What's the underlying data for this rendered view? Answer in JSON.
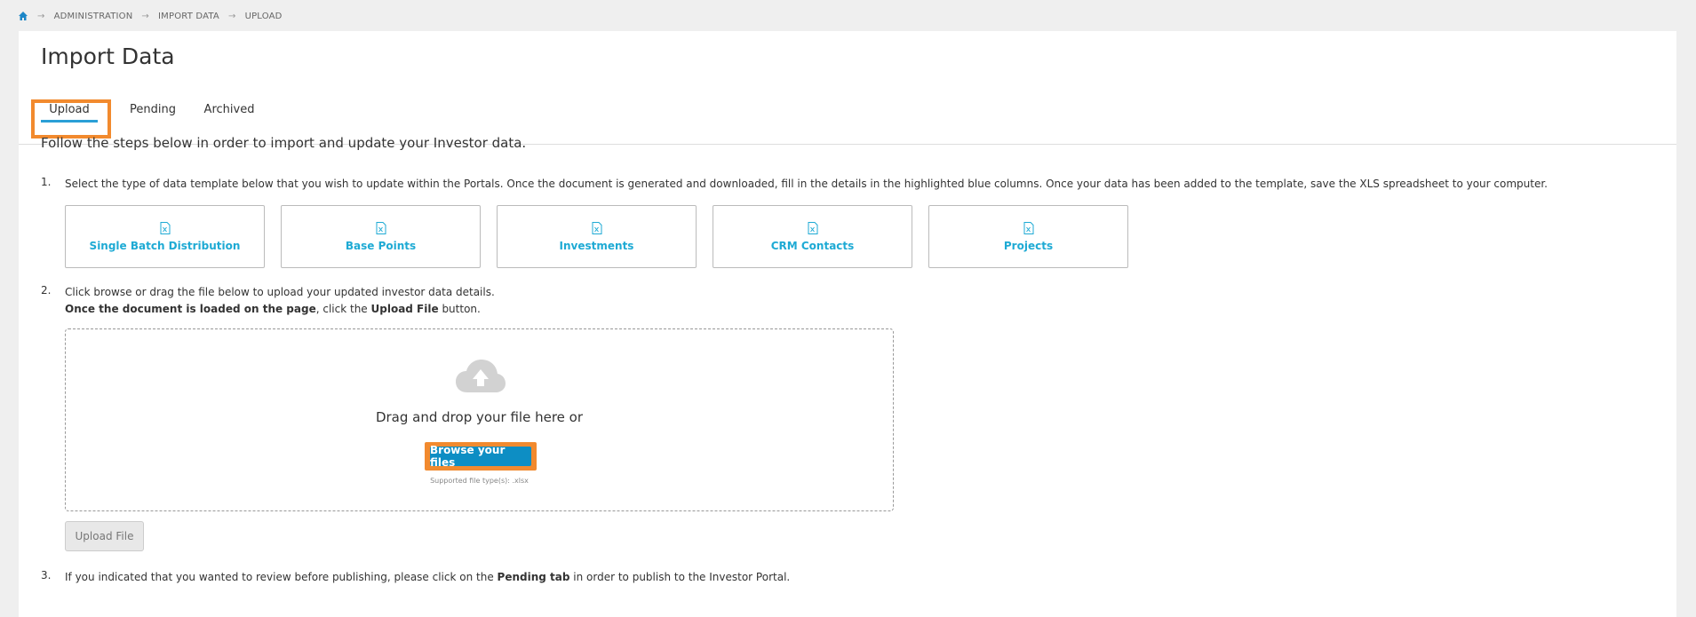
{
  "breadcrumb": {
    "home_icon": "home-icon",
    "items": [
      "ADMINISTRATION",
      "IMPORT DATA",
      "UPLOAD"
    ]
  },
  "page": {
    "title": "Import Data"
  },
  "tabs": [
    {
      "label": "Upload",
      "active": true
    },
    {
      "label": "Pending",
      "active": false
    },
    {
      "label": "Archived",
      "active": false
    }
  ],
  "intro": "Follow the steps below in order to import and update your Investor data.",
  "steps": {
    "step1": {
      "num": "1.",
      "text": "Select the type of data template below that you wish to update within the Portals. Once the document is generated and downloaded, fill in the details in the highlighted blue columns. Once your data has been added to the template, save the XLS spreadsheet to your computer."
    },
    "step2": {
      "num": "2.",
      "line1": "Click browse or drag the file below to upload your updated investor data details.",
      "line2_bold": "Once the document is loaded on the page",
      "line2_mid": ", click the ",
      "line2_bold2": "Upload File",
      "line2_end": " button."
    },
    "step3": {
      "num": "3.",
      "text_a": "If you indicated that you wanted to review before publishing, please click on the ",
      "text_bold": "Pending tab",
      "text_b": " in order to publish to the Investor Portal."
    }
  },
  "templates": [
    {
      "label": "Single Batch Distribution",
      "icon": "excel-file-icon"
    },
    {
      "label": "Base Points",
      "icon": "excel-file-icon"
    },
    {
      "label": "Investments",
      "icon": "excel-file-icon"
    },
    {
      "label": "CRM Contacts",
      "icon": "excel-file-icon"
    },
    {
      "label": "Projects",
      "icon": "excel-file-icon"
    }
  ],
  "dropzone": {
    "icon": "cloud-upload-icon",
    "text": "Drag and drop your file here or",
    "browse_label": "Browse your files",
    "supported": "Supported file type(s): .xlsx"
  },
  "upload_button": "Upload File",
  "colors": {
    "accent": "#1eaad4",
    "browse": "#0d8ec4",
    "highlight": "#f28a2e"
  }
}
